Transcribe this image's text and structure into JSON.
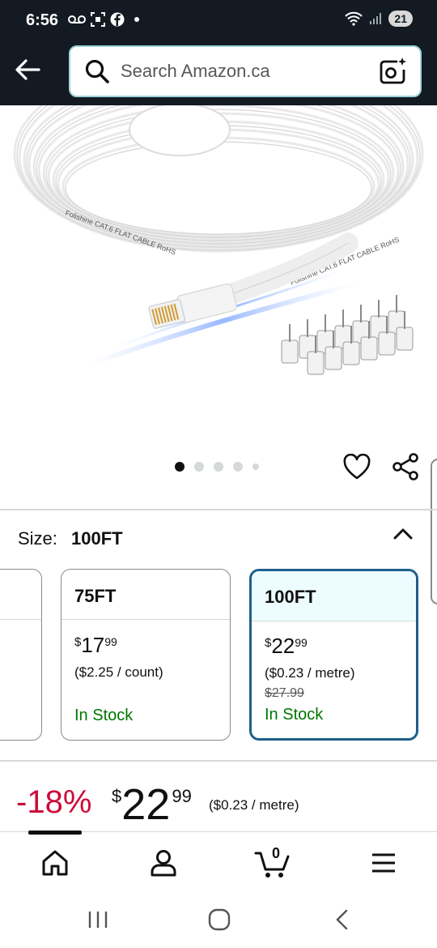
{
  "status_bar": {
    "time": "6:56",
    "battery": "21",
    "left_icons": [
      "voicemail-icon",
      "screenshot-icon",
      "facebook-icon",
      "dot-icon"
    ],
    "right_icons": [
      "wifi-icon",
      "signal-icon"
    ]
  },
  "header": {
    "search_placeholder": "Search Amazon.ca",
    "icons": [
      "back-arrow-icon",
      "search-icon",
      "camera-search-icon"
    ]
  },
  "product_image": {
    "cable_print_1": "Folishine CAT.6 FLAT CABLE RoHS",
    "cable_print_2": "Folishine CAT.6 FLAT CABLE RoHS",
    "carousel_dots": 5,
    "carousel_active": 0
  },
  "size": {
    "label": "Size:",
    "value": "100FT",
    "options": [
      {
        "name": "75FT",
        "price_symbol": "$",
        "price_whole": "17",
        "price_cents": "99",
        "unit_price": "($2.25 / count)",
        "list_price": "",
        "availability": "In Stock"
      },
      {
        "name": "100FT",
        "price_symbol": "$",
        "price_whole": "22",
        "price_cents": "99",
        "unit_price": "($0.23 / metre)",
        "list_price": "$27.99",
        "availability": "In Stock"
      }
    ]
  },
  "price_block": {
    "discount": "-18%",
    "symbol": "$",
    "whole": "22",
    "cents": "99",
    "unit": "($0.23 / metre)"
  },
  "bottom_nav": {
    "cart_count": "0",
    "items": [
      "home-icon",
      "account-icon",
      "cart-icon",
      "menu-icon"
    ]
  },
  "colors": {
    "header_bg": "#131a22",
    "search_border": "#9fd3dc",
    "discount": "#cc0c39",
    "in_stock": "#007600",
    "selected_border": "#1f5f8b",
    "selected_head_bg": "#edfdff"
  }
}
